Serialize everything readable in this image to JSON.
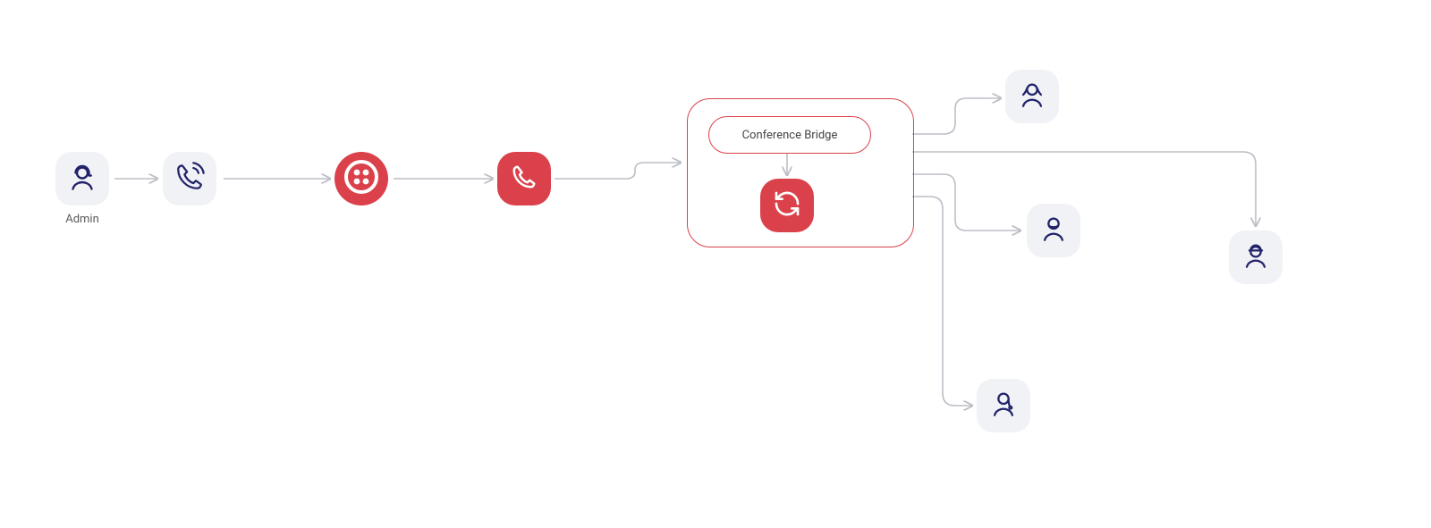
{
  "colors": {
    "accent": "#db414a",
    "node_bg": "#f1f2f6",
    "line": "#bdbdc7",
    "ink": "#22236a"
  },
  "nodes": {
    "admin": {
      "label": "Admin",
      "icon": "person-headset-icon"
    },
    "call": {
      "icon": "phone-ringing-icon"
    },
    "twilio": {
      "icon": "twilio-logo-icon"
    },
    "phone": {
      "icon": "phone-icon"
    },
    "bridge": {
      "label": "Conference Bridge",
      "icon": "sync-icon"
    },
    "user_a": {
      "icon": "person-woman-icon"
    },
    "user_b": {
      "icon": "person-man-icon"
    },
    "user_c": {
      "icon": "person-girl-icon"
    },
    "user_d": {
      "icon": "person-worker-icon"
    }
  }
}
